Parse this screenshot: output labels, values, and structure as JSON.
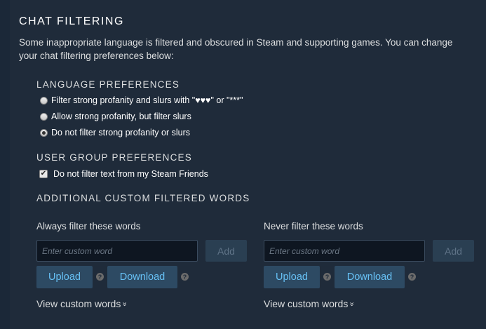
{
  "page": {
    "title": "CHAT FILTERING",
    "intro": "Some inappropriate language is filtered and obscured in Steam and supporting games. You can change your chat filtering preferences below:"
  },
  "language_preferences": {
    "heading": "LANGUAGE PREFERENCES",
    "options": [
      {
        "label": "Filter strong profanity and slurs with \"♥♥♥\" or \"***\"",
        "selected": false
      },
      {
        "label": "Allow strong profanity, but filter slurs",
        "selected": false
      },
      {
        "label": "Do not filter strong profanity or slurs",
        "selected": true
      }
    ]
  },
  "user_group_preferences": {
    "heading": "USER GROUP PREFERENCES",
    "checkbox_label": "Do not filter text from my Steam Friends",
    "checked": true
  },
  "custom_words": {
    "heading": "ADDITIONAL CUSTOM FILTERED WORDS",
    "always": {
      "label": "Always filter these words",
      "placeholder": "Enter custom word",
      "add_label": "Add",
      "upload_label": "Upload",
      "download_label": "Download",
      "help_glyph": "?",
      "view_label": "View custom words",
      "chevron": "»"
    },
    "never": {
      "label": "Never filter these words",
      "placeholder": "Enter custom word",
      "add_label": "Add",
      "upload_label": "Upload",
      "download_label": "Download",
      "help_glyph": "?",
      "view_label": "View custom words",
      "chevron": "»"
    }
  },
  "colors": {
    "background": "#1b2838",
    "panel": "#1f2b3a",
    "link_blue": "#67c1f5",
    "button_blue": "#2d4a63"
  }
}
